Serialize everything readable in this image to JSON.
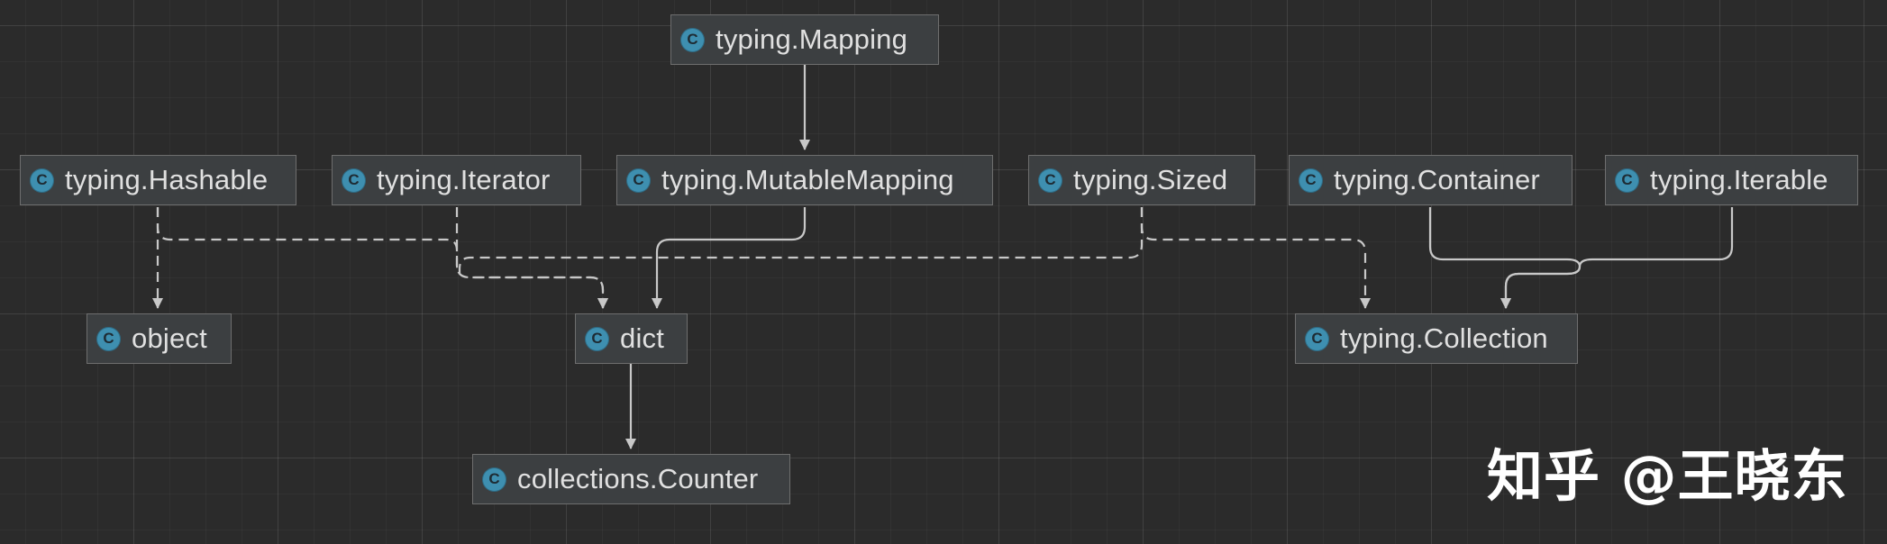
{
  "nodes": [
    {
      "id": "mapping",
      "label": "typing.Mapping",
      "icon": "class-c-icon"
    },
    {
      "id": "hashable",
      "label": "typing.Hashable",
      "icon": "class-c-icon"
    },
    {
      "id": "iterator",
      "label": "typing.Iterator",
      "icon": "class-c-icon"
    },
    {
      "id": "mutablemapping",
      "label": "typing.MutableMapping",
      "icon": "class-c-icon"
    },
    {
      "id": "sized",
      "label": "typing.Sized",
      "icon": "class-c-icon"
    },
    {
      "id": "container",
      "label": "typing.Container",
      "icon": "class-c-icon"
    },
    {
      "id": "iterable",
      "label": "typing.Iterable",
      "icon": "class-c-icon"
    },
    {
      "id": "object",
      "label": "object",
      "icon": "class-c-icon"
    },
    {
      "id": "dict",
      "label": "dict",
      "icon": "class-c-icon"
    },
    {
      "id": "collection",
      "label": "typing.Collection",
      "icon": "class-c-icon"
    },
    {
      "id": "counter",
      "label": "collections.Counter",
      "icon": "class-c-icon"
    }
  ],
  "icon_glyph": "C",
  "edges": [
    {
      "from": "mapping",
      "to": "mutablemapping",
      "style": "solid"
    },
    {
      "from": "hashable",
      "to": "object",
      "style": "dashed"
    },
    {
      "from": "hashable",
      "to": "dict",
      "style": "dashed"
    },
    {
      "from": "iterator",
      "to": "dict",
      "style": "dashed"
    },
    {
      "from": "sized",
      "to": "dict",
      "style": "dashed"
    },
    {
      "from": "mutablemapping",
      "to": "dict",
      "style": "solid"
    },
    {
      "from": "sized",
      "to": "collection",
      "style": "dashed"
    },
    {
      "from": "container",
      "to": "collection",
      "style": "solid"
    },
    {
      "from": "iterable",
      "to": "collection",
      "style": "solid"
    },
    {
      "from": "dict",
      "to": "counter",
      "style": "solid"
    }
  ],
  "colors": {
    "background": "#2b2b2b",
    "node_fill": "#3c3f41",
    "node_border": "#6e6e6e",
    "icon": "#3e8fb0",
    "edge": "#c8c8c8"
  },
  "watermark": "知乎 @王晓东"
}
